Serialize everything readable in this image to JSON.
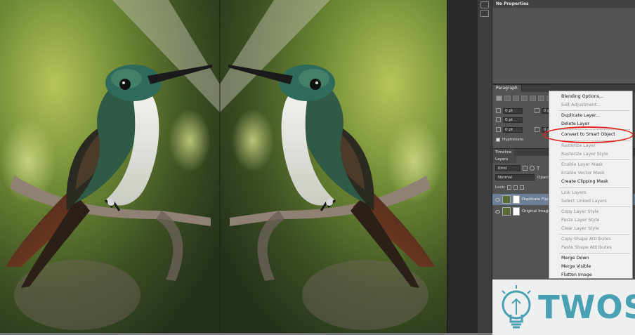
{
  "properties_panel": {
    "title": "No Properties"
  },
  "paragraph_panel": {
    "tab": "Paragraph",
    "indent_values": [
      "0 pt",
      "0 pt",
      "0 pt",
      "0 pt",
      "0 pt"
    ],
    "hyphenate_label": "Hyphenate"
  },
  "timeline_panel": {
    "tab": "Timeline"
  },
  "layers_panel": {
    "tab": "Layers",
    "filter_kind": "Kind",
    "blend_mode": "Normal",
    "opacity_label": "Opaci",
    "lock_label": "Lock:",
    "layers": [
      {
        "name": "Duplicate Flippe"
      },
      {
        "name": "Original Image"
      }
    ]
  },
  "context_menu": {
    "items": [
      {
        "label": "Blending Options...",
        "enabled": true
      },
      {
        "label": "Edit Adjustment...",
        "enabled": false
      },
      {
        "label": "Duplicate Layer...",
        "enabled": true
      },
      {
        "label": "Delete Layer",
        "enabled": true
      },
      {
        "label": "Convert to Smart Object",
        "enabled": true
      },
      {
        "label": "Rasterize Layer",
        "enabled": false
      },
      {
        "label": "Rasterize Layer Style",
        "enabled": false
      },
      {
        "label": "Enable Layer Mask",
        "enabled": false
      },
      {
        "label": "Enable Vector Mask",
        "enabled": false
      },
      {
        "label": "Create Clipping Mask",
        "enabled": true
      },
      {
        "label": "Link Layers",
        "enabled": false
      },
      {
        "label": "Select Linked Layers",
        "enabled": false
      },
      {
        "label": "Copy Layer Style",
        "enabled": false
      },
      {
        "label": "Paste Layer Style",
        "enabled": false
      },
      {
        "label": "Clear Layer Style",
        "enabled": false
      },
      {
        "label": "Copy Shape Attributes",
        "enabled": false
      },
      {
        "label": "Paste Shape Attributes",
        "enabled": false
      },
      {
        "label": "Merge Down",
        "enabled": true
      },
      {
        "label": "Merge Visible",
        "enabled": true
      },
      {
        "label": "Flatten Image",
        "enabled": true
      }
    ],
    "highlighted_item": "Convert to Smart Object",
    "highlight_color": "#e0251f"
  },
  "watermark": {
    "brand": "TWOS",
    "color": "#4aa0b3"
  },
  "canvas": {
    "subject": "mirrored hummingbird photo"
  }
}
